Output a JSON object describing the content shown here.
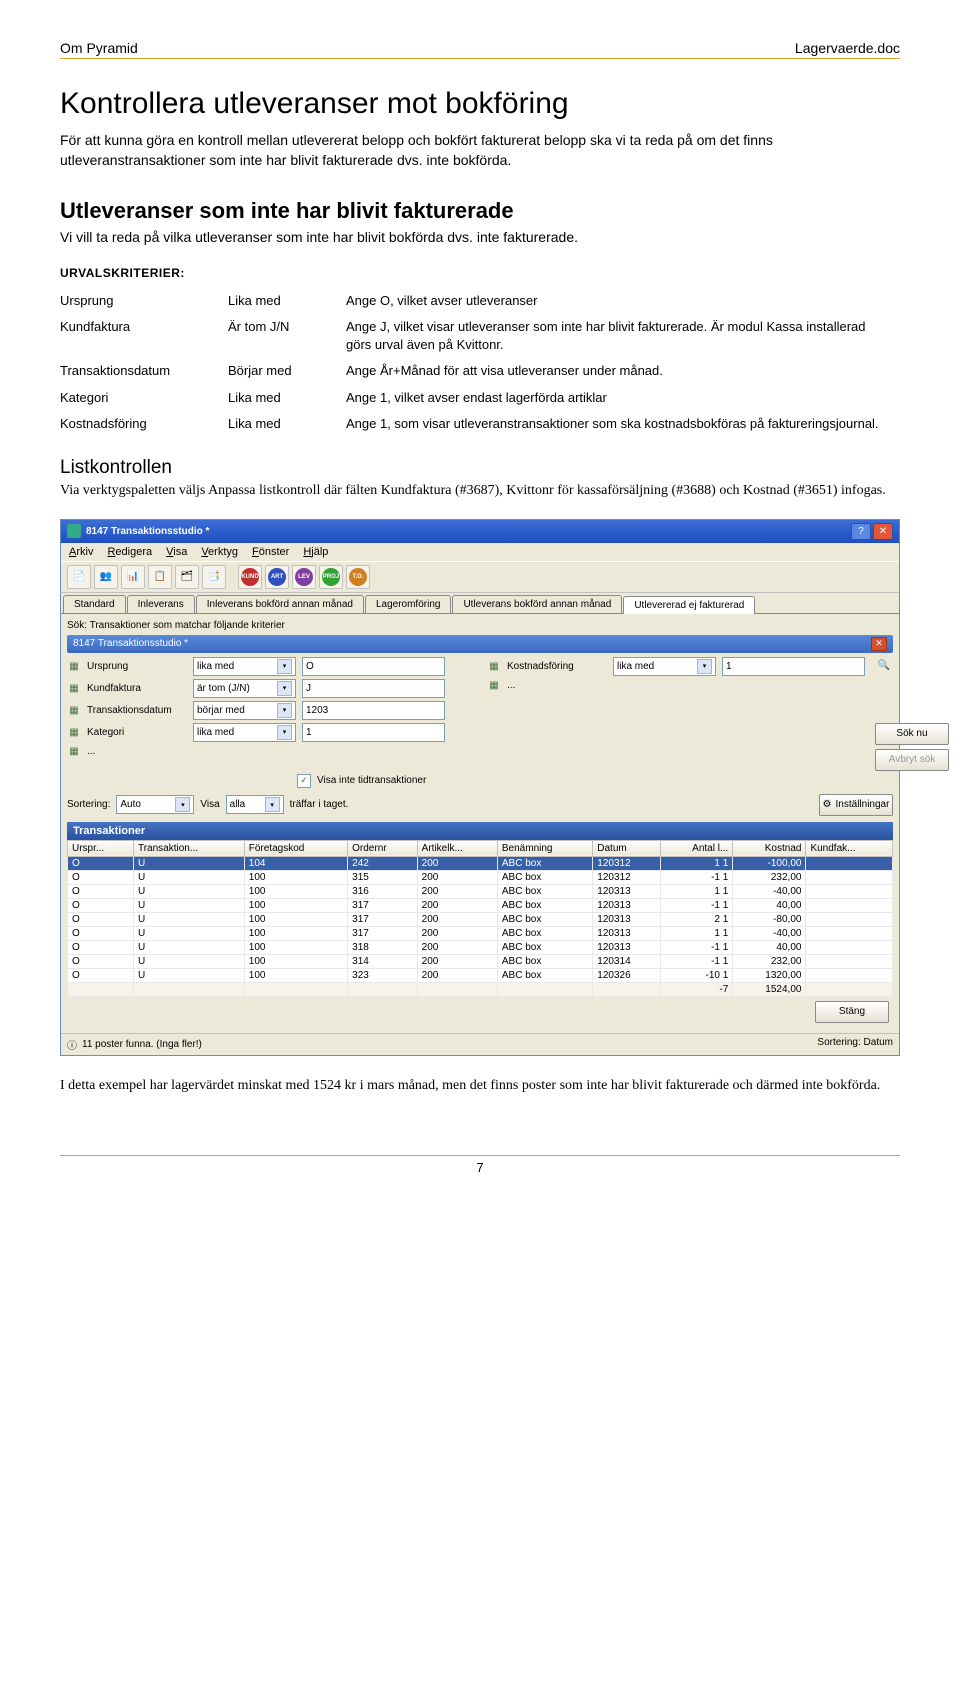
{
  "header": {
    "left": "Om Pyramid",
    "right": "Lagervaerde.doc"
  },
  "h1": "Kontrollera utleveranser mot bokföring",
  "intro": "För att kunna göra en kontroll mellan utlevererat belopp och bokfört fakturerat belopp ska vi ta reda på om det finns utleveranstransaktioner som inte har blivit fakturerade dvs. inte bokförda.",
  "h2": "Utleveranser som inte har blivit fakturerade",
  "sub": "Vi vill ta reda på vilka utleveranser som inte har blivit bokförda dvs. inte fakturerade.",
  "urval": "URVALSKRITERIER:",
  "criteria": [
    {
      "a": "Ursprung",
      "b": "Lika med",
      "c": "Ange O, vilket avser utleveranser"
    },
    {
      "a": "Kundfaktura",
      "b": "Är tom J/N",
      "c": "Ange J, vilket visar utleveranser som inte har blivit fakturerade. Är modul Kassa installerad görs urval även på Kvittonr."
    },
    {
      "a": "Transaktionsdatum",
      "b": "Börjar med",
      "c": "Ange År+Månad för att visa utleveranser under månad."
    },
    {
      "a": "Kategori",
      "b": "Lika med",
      "c": "Ange 1, vilket avser endast lagerförda artiklar"
    },
    {
      "a": "Kostnadsföring",
      "b": "Lika med",
      "c": "Ange 1, som visar utleveranstransaktioner som ska kostnadsbokföras på faktureringsjournal."
    }
  ],
  "h3": "Listkontrollen",
  "listk": "Via verktygspaletten väljs Anpassa listkontroll där fälten Kundfaktura (#3687), Kvittonr för kassaförsäljning (#3688) och Kostnad (#3651) infogas.",
  "win": {
    "title": "8147 Transaktionsstudio *",
    "menu": [
      "Arkiv",
      "Redigera",
      "Visa",
      "Verktyg",
      "Fönster",
      "Hjälp"
    ],
    "tabs": [
      "Standard",
      "Inleverans",
      "Inleverans bokförd annan månad",
      "Lageromföring",
      "Utleverans bokförd annan månad",
      "Utlevererad ej fakturerad"
    ],
    "subtitle": "8147 Transaktionsstudio *",
    "sok_label": "Sök: Transaktioner som matchar följande kriterier",
    "filters_left": [
      {
        "l": "Ursprung",
        "op": "lika med",
        "v": "O"
      },
      {
        "l": "Kundfaktura",
        "op": "är tom (J/N)",
        "v": "J"
      },
      {
        "l": "Transaktionsdatum",
        "op": "börjar med",
        "v": "1203"
      },
      {
        "l": "Kategori",
        "op": "lika med",
        "v": "1"
      },
      {
        "l": "...",
        "op": "",
        "v": ""
      }
    ],
    "filters_right": [
      {
        "l": "Kostnadsföring",
        "op": "lika med",
        "v": "1"
      },
      {
        "l": "...",
        "op": "",
        "v": ""
      }
    ],
    "chk_label": "Visa inte tidtransaktioner",
    "sok_btn": "Sök nu",
    "avbryt_btn": "Avbryt sök",
    "sort_label": "Sortering:",
    "sort_val": "Auto",
    "visa_label": "Visa",
    "visa_val": "alla",
    "visa_suffix": "träffar i taget.",
    "inst_btn": "Inställningar",
    "thdr": "Transaktioner",
    "cols": [
      "Urspr...",
      "Transaktion...",
      "Företagskod",
      "Ordernr",
      "Artikelk...",
      "Benämning",
      "Datum",
      "Antal l...",
      "Kostnad",
      "Kundfak..."
    ],
    "rows": [
      [
        "O",
        "U",
        "104",
        "242",
        "200",
        "ABC box",
        "120312",
        "1 1",
        "-100,00",
        ""
      ],
      [
        "O",
        "U",
        "100",
        "315",
        "200",
        "ABC box",
        "120312",
        "-1 1",
        "232,00",
        ""
      ],
      [
        "O",
        "U",
        "100",
        "316",
        "200",
        "ABC box",
        "120313",
        "1 1",
        "-40,00",
        ""
      ],
      [
        "O",
        "U",
        "100",
        "317",
        "200",
        "ABC box",
        "120313",
        "-1 1",
        "40,00",
        ""
      ],
      [
        "O",
        "U",
        "100",
        "317",
        "200",
        "ABC box",
        "120313",
        "2 1",
        "-80,00",
        ""
      ],
      [
        "O",
        "U",
        "100",
        "317",
        "200",
        "ABC box",
        "120313",
        "1 1",
        "-40,00",
        ""
      ],
      [
        "O",
        "U",
        "100",
        "318",
        "200",
        "ABC box",
        "120313",
        "-1 1",
        "40,00",
        ""
      ],
      [
        "O",
        "U",
        "100",
        "314",
        "200",
        "ABC box",
        "120314",
        "-1 1",
        "232,00",
        ""
      ],
      [
        "O",
        "U",
        "100",
        "323",
        "200",
        "ABC box",
        "120326",
        "-10 1",
        "1320,00",
        ""
      ]
    ],
    "total": [
      "",
      "",
      "",
      "",
      "",
      "",
      "",
      "-7",
      "1524,00",
      ""
    ],
    "stang": "Stäng",
    "status_left": "11 poster funna. (Inga fler!)",
    "status_right": "Sortering: Datum"
  },
  "after": "I detta exempel har lagervärdet minskat med 1524 kr i mars månad, men det finns poster som inte har blivit fakturerade och därmed inte bokförda.",
  "page": "7"
}
